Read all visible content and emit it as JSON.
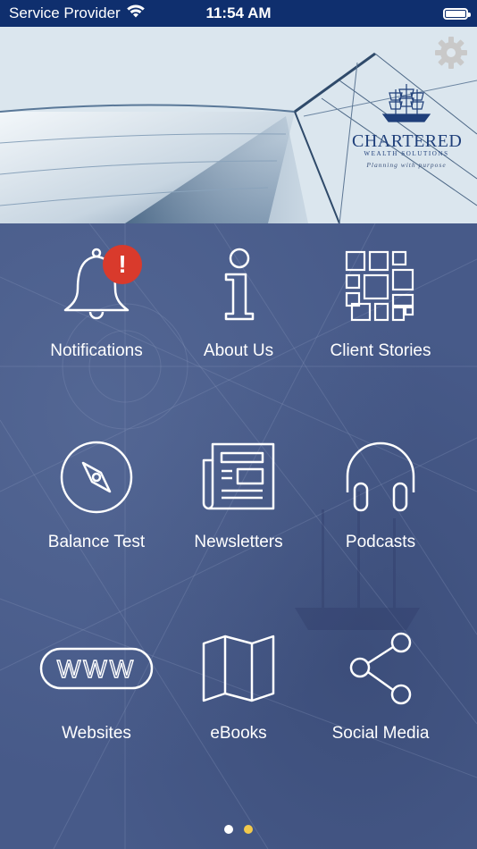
{
  "status_bar": {
    "carrier": "Service Provider",
    "time": "11:54 AM",
    "wifi_icon": "wifi-icon",
    "battery_icon": "battery-icon"
  },
  "header": {
    "logo": {
      "brand": "CHARTERED",
      "sub": "WEALTH SOLUTIONS",
      "tagline": "Planning with purpose"
    },
    "settings_icon": "gear-icon"
  },
  "grid": {
    "tiles": [
      {
        "label": "Notifications",
        "icon": "bell-icon",
        "badge": "!"
      },
      {
        "label": "About Us",
        "icon": "info-icon"
      },
      {
        "label": "Client Stories",
        "icon": "grid-pattern-icon"
      },
      {
        "label": "Balance Test",
        "icon": "compass-icon"
      },
      {
        "label": "Newsletters",
        "icon": "newspaper-icon"
      },
      {
        "label": "Podcasts",
        "icon": "headphones-icon"
      },
      {
        "label": "Websites",
        "icon": "www-icon",
        "icon_text": "WWW"
      },
      {
        "label": "eBooks",
        "icon": "map-icon"
      },
      {
        "label": "Social Media",
        "icon": "share-icon"
      }
    ]
  },
  "pagination": {
    "pages": 2,
    "current": 2,
    "colors": {
      "inactive": "#ffffff",
      "active": "#f2c94c"
    }
  },
  "colors": {
    "status_bar": "#0f2f6e",
    "background": "#475a89",
    "logo": "#1f3f7a",
    "badge": "#d93a2c"
  }
}
